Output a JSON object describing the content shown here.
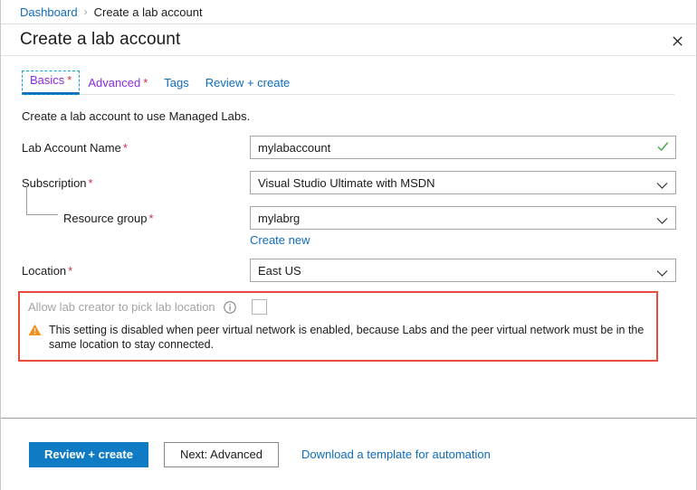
{
  "breadcrumb": {
    "root": "Dashboard",
    "separator": "›",
    "current": "Create a lab account"
  },
  "header": {
    "title": "Create a lab account",
    "close_icon": "close-icon"
  },
  "tabs": [
    {
      "label": "Basics",
      "required": "*",
      "state": "active"
    },
    {
      "label": "Advanced",
      "required": "*",
      "state": "visited"
    },
    {
      "label": "Tags",
      "required": "",
      "state": "default"
    },
    {
      "label": "Review + create",
      "required": "",
      "state": "default"
    }
  ],
  "form": {
    "intro": "Create a lab account to use Managed Labs.",
    "fields": [
      {
        "label": "Lab Account Name",
        "required": "*",
        "value": "mylabaccount",
        "placeholder": "",
        "control": "textbox",
        "validation_icon": "checkmark-icon"
      },
      {
        "label": "Subscription",
        "required": "*",
        "value": "Visual Studio Ultimate with MSDN",
        "control": "dropdown"
      },
      {
        "label": "Resource group",
        "required": "*",
        "value": "mylabrg",
        "control": "dropdown",
        "indented": true,
        "sub_link": "Create new"
      },
      {
        "label": "Location",
        "required": "*",
        "value": "East US",
        "control": "dropdown"
      }
    ],
    "highlighted_setting": {
      "label": "Allow lab creator to pick lab location",
      "disabled": true,
      "info_icon": "info-icon",
      "checkbox_checked": false,
      "warning_icon": "warning-triangle-icon",
      "warning_text": "This setting is disabled when peer virtual network is enabled, because Labs and the peer virtual network must be in the same location to stay connected."
    }
  },
  "footer": {
    "primary_label": "Review + create",
    "secondary_label": "Next: Advanced",
    "link_label": "Download a template for automation"
  },
  "colors": {
    "accent_blue": "#0f6cbd",
    "primary_button": "#0f7bc4",
    "required_red": "#c4314b",
    "highlight_red": "#e64b3c",
    "warning_orange": "#f3901d",
    "success_green": "#4da64d",
    "tab_visited_purple": "#8a2be2",
    "focus_cyan": "#13a0d8"
  }
}
